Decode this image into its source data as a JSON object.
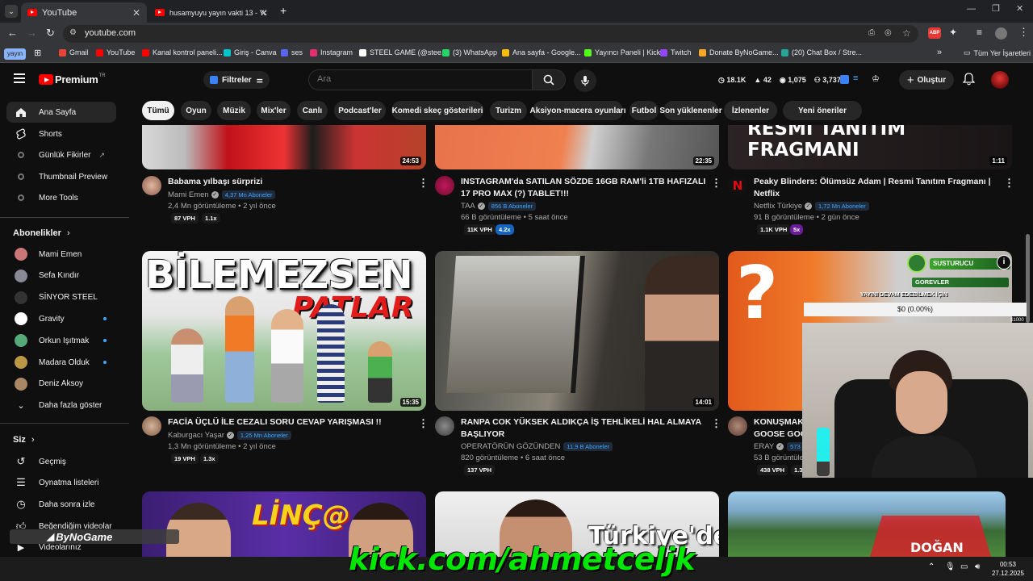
{
  "browser": {
    "tabs": [
      {
        "title": "YouTube",
        "active": true
      },
      {
        "title": "husamyuyu yayın vakti 13 - You"
      }
    ],
    "url": "youtube.com",
    "profile_chip": "yayın",
    "bookmarks": [
      {
        "label": "Gmail",
        "color": "#ea4335"
      },
      {
        "label": "YouTube",
        "color": "#ff0000"
      },
      {
        "label": "Kanal kontrol paneli...",
        "color": "#ff0000"
      },
      {
        "label": "Giriş - Canva",
        "color": "#00c4cc"
      },
      {
        "label": "ses",
        "color": "#5865f2"
      },
      {
        "label": "Instagram",
        "color": "#e1306c"
      },
      {
        "label": "STEEL GAME (@stee...",
        "color": "#ffffff"
      },
      {
        "label": "(3) WhatsApp",
        "color": "#25d366"
      },
      {
        "label": "Ana sayfa - Google...",
        "color": "#fbbc04"
      },
      {
        "label": "Yayıncı Paneli | Kick",
        "color": "#53fc18"
      },
      {
        "label": "Twitch",
        "color": "#9146ff"
      },
      {
        "label": "Donate ByNoGame...",
        "color": "#f9a825"
      },
      {
        "label": "(20) Chat Box / Stre...",
        "color": "#26a69a"
      }
    ],
    "all_bookmarks": "Tüm Yer İşaretleri"
  },
  "header": {
    "logo": "Premium",
    "logo_sup": "TR",
    "filters": "Filtreler",
    "search_placeholder": "Ara",
    "stats": [
      "18.1K",
      "42",
      "1,075",
      "3,737"
    ],
    "create": "Oluştur"
  },
  "chips": [
    "Tümü",
    "Oyun",
    "Müzik",
    "Mix'ler",
    "Canlı",
    "Podcast'ler",
    "Komedi skeç gösterileri",
    "Turizm",
    "Aksiyon-macera oyunları",
    "Futbol",
    "Son yüklenenler",
    "İzlenenler",
    "Yeni öneriler"
  ],
  "sidebar": {
    "main": [
      "Ana Sayfa",
      "Shorts",
      "Günlük Fikirler",
      "Thumbnail Preview",
      "More Tools"
    ],
    "subs_header": "Abonelikler",
    "subs": [
      {
        "name": "Mami Emen",
        "color": "#c77"
      },
      {
        "name": "Sefa Kındır",
        "color": "#889"
      },
      {
        "name": "SİNYOR STEEL",
        "color": "#333"
      },
      {
        "name": "Gravity",
        "color": "#fff"
      },
      {
        "name": "Orkun Işıtmak",
        "color": "#5a7"
      },
      {
        "name": "Madara Olduk",
        "color": "#b94"
      },
      {
        "name": "Deniz Aksoy",
        "color": "#a86"
      }
    ],
    "more": "Daha fazla göster",
    "you_header": "Siz",
    "you": [
      "Geçmiş",
      "Oynatma listeleri",
      "Daha sonra izle",
      "Beğendiğim videolar",
      "Videolarınız"
    ]
  },
  "videos_top": [
    {
      "title": "Babama yılbaşı sürprizi",
      "channel": "Mami Emen",
      "subs": "4,37 Mn Aboneler",
      "meta": "2,4 Mn görüntüleme • 2 yıl önce",
      "vph": "87 VPH",
      "mult": "1.1x",
      "dur": "24:53"
    },
    {
      "title": "INSTAGRAM'da SATILAN SÖZDE 16GB RAM'li 1TB HAFIZALI 17 PRO MAX (?) TABLET!!!",
      "channel": "TAA",
      "subs": "856 B Aboneler",
      "meta": "66 B görüntüleme • 5 saat önce",
      "vph": "11K VPH",
      "mult": "4.2x",
      "dur": "22:35"
    },
    {
      "title": "Peaky Blinders: Ölümsüz Adam | Resmi Tanıtım Fragmanı | Netflix",
      "channel": "Netflix Türkiye",
      "subs": "1,72 Mn Aboneler",
      "meta": "91 B görüntüleme • 2 gün önce",
      "vph": "1.1K VPH",
      "mult": "5x",
      "dur": "1:11",
      "thumb_text": "RESMİ TANITIM FRAGMANI"
    }
  ],
  "videos_mid": [
    {
      "title": "FACİA ÜÇLÜ İLE CEZALI SORU CEVAP YARIŞMASI !!",
      "channel": "Kaburgacı Yaşar",
      "subs": "1,25 Mn Aboneler",
      "meta": "1,3 Mn görüntüleme • 2 yıl önce",
      "vph": "19 VPH",
      "mult": "1.3x",
      "dur": "15:35",
      "thumb_text1": "BİLEMEZSEN",
      "thumb_text2": "PATLAR"
    },
    {
      "title": "RANPA COK YÜKSEK ALDIKÇA İŞ TEHLİKELİ HAL ALMAYA BAŞLIYOR",
      "channel": "OPERATÖRÜN GÖZÜNDEN",
      "subs": "11,9 B Aboneler",
      "meta": "820 görüntüleme • 6 saat önce",
      "vph": "137 VPH",
      "dur": "14:01"
    },
    {
      "title": "KONUŞMAK",
      "title2": "GOOSE GOO",
      "channel": "ERAY",
      "subs": "573",
      "meta": "53 B görüntüleme",
      "vph": "438 VPH",
      "mult": "1.3"
    }
  ],
  "videos_bottom": [
    {
      "thumb_text": "LİNÇ@"
    },
    {
      "thumb_text": "Türkiye'de"
    },
    {
      "thumb_text": "DOĞAN"
    }
  ],
  "overlay": {
    "goal_amount": "$0 (0.00%)",
    "goal_title": "SUSTURUCU",
    "goal_sub": "GOREVLER",
    "goal_caption": "YAYINI DEVAM EDEBİLMEK İÇİN",
    "goal_right": "$1000",
    "kick": "kick.com/ahmetceljk",
    "bynogame": "ByNoGame"
  },
  "taskbar": {
    "time": "00:53",
    "date": "27.12.2025"
  }
}
